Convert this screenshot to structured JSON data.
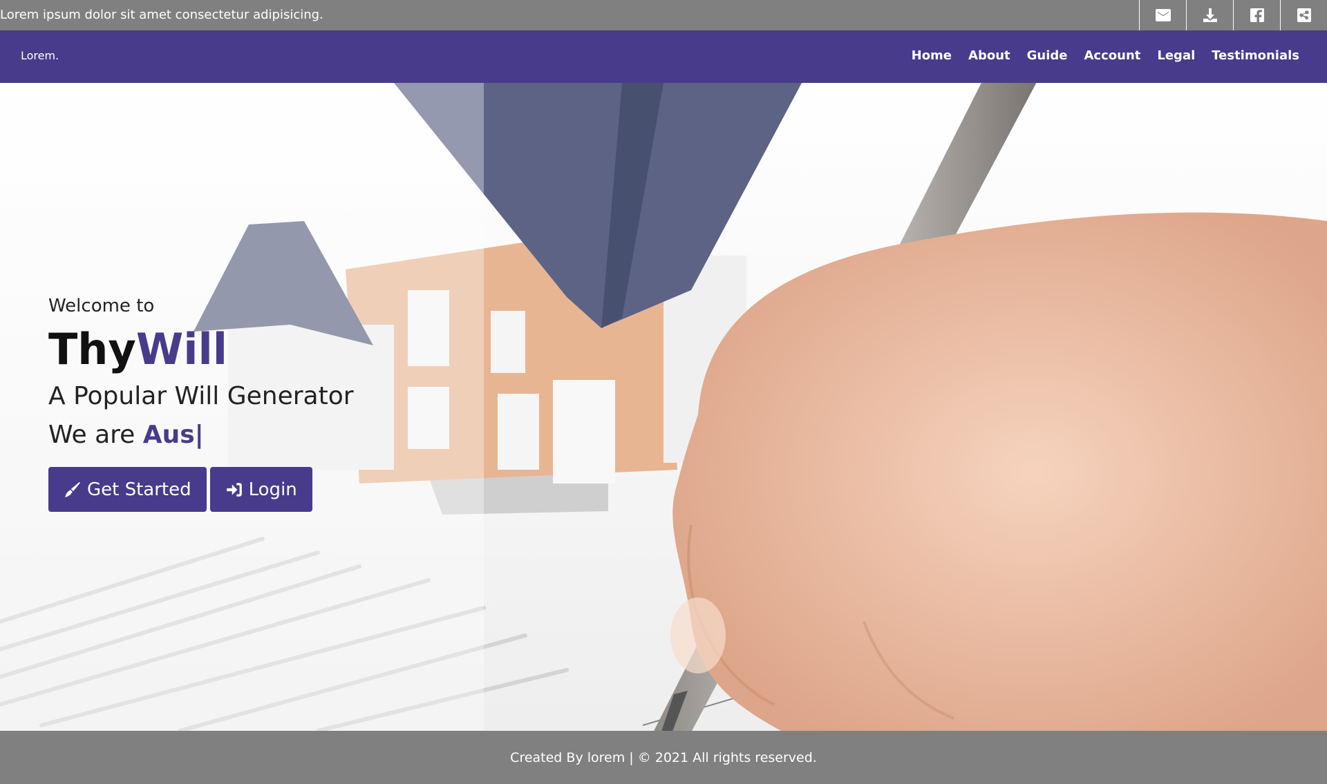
{
  "topbar": {
    "text": "Lorem ipsum dolor sit amet consectetur adipisicing.",
    "icons": [
      "envelope-icon",
      "download-icon",
      "facebook-icon",
      "share-icon"
    ]
  },
  "navbar": {
    "brand": "Lorem.",
    "links": [
      "Home",
      "About",
      "Guide",
      "Account",
      "Legal",
      "Testimonials"
    ]
  },
  "hero": {
    "welcome": "Welcome to",
    "title_part1": "Thy",
    "title_part2": "Will",
    "tagline": "A Popular Will Generator",
    "typed_prefix": "We are ",
    "typed_text": "Aus",
    "typed_cursor": "|",
    "buttons": {
      "get_started": "Get Started",
      "login": "Login"
    }
  },
  "footer": {
    "text": "Created By lorem | © 2021 All rights reserved."
  },
  "colors": {
    "accent": "#483b8c",
    "bar_gray": "#808080"
  }
}
